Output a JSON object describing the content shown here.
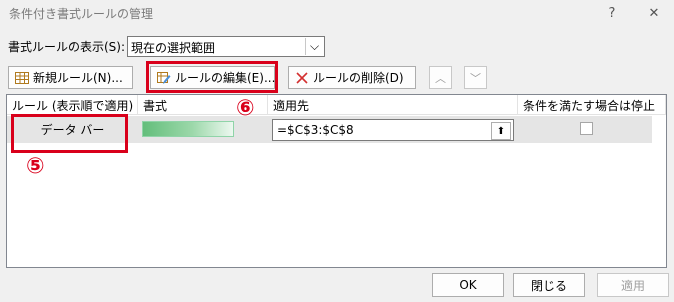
{
  "window": {
    "title": "条件付き書式ルールの管理",
    "help_glyph": "?",
    "close_glyph": "✕"
  },
  "show_rules": {
    "label": "書式ルールの表示(S):",
    "selected": "現在の選択範囲",
    "arrow_glyph": "⌵"
  },
  "toolbar": {
    "new_rule": "新規ルール(N)...",
    "edit_rule": "ルールの編集(E)...",
    "delete_rule": "ルールの削除(D)",
    "move_up_glyph": "︿",
    "move_down_glyph": "﹀"
  },
  "table": {
    "headers": [
      "ルール (表示順で適用)",
      "書式",
      "適用先",
      "条件を満たす場合は停止"
    ],
    "rows": [
      {
        "rule": "データ バー",
        "applies_to": "=$C$3:$C$8",
        "stop_if_true": false
      }
    ],
    "collapse_glyph": "⬆"
  },
  "annotations": {
    "five": "⑤",
    "six": "⑥",
    "color": "#d9001b"
  },
  "footer": {
    "ok": "OK",
    "close": "閉じる",
    "apply": "適用"
  },
  "colors": {
    "databar_start": "#63be7b",
    "databar_end": "#edf8f0",
    "selected_row": "#e5e5e5"
  }
}
